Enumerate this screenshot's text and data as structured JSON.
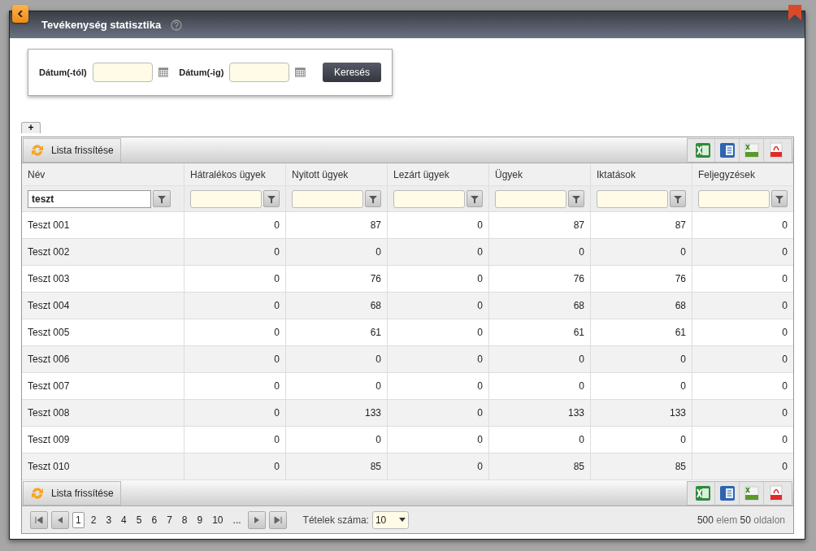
{
  "window": {
    "title": "Tevékenység statisztika"
  },
  "search_form": {
    "fields": [
      {
        "label": "Dátum(-tól)"
      },
      {
        "label": "Dátum(-ig)"
      }
    ],
    "button": "Keresés"
  },
  "add_tab": "+",
  "toolbar": {
    "refresh": "Lista frissítése",
    "exports": [
      {
        "kind": "excel"
      },
      {
        "kind": "word"
      },
      {
        "kind": "csv"
      },
      {
        "kind": "pdf"
      }
    ]
  },
  "table": {
    "columns": [
      "Név",
      "Hátralékos ügyek",
      "Nyitott ügyek",
      "Lezárt ügyek",
      "Ügyek",
      "Iktatások",
      "Feljegyzések"
    ],
    "name_filter": "teszt",
    "rows": [
      [
        "Teszt 001",
        "0",
        "87",
        "0",
        "87",
        "87",
        "0"
      ],
      [
        "Teszt 002",
        "0",
        "0",
        "0",
        "0",
        "0",
        "0"
      ],
      [
        "Teszt 003",
        "0",
        "76",
        "0",
        "76",
        "76",
        "0"
      ],
      [
        "Teszt 004",
        "0",
        "68",
        "0",
        "68",
        "68",
        "0"
      ],
      [
        "Teszt 005",
        "0",
        "61",
        "0",
        "61",
        "61",
        "0"
      ],
      [
        "Teszt 006",
        "0",
        "0",
        "0",
        "0",
        "0",
        "0"
      ],
      [
        "Teszt 007",
        "0",
        "0",
        "0",
        "0",
        "0",
        "0"
      ],
      [
        "Teszt 008",
        "0",
        "133",
        "0",
        "133",
        "133",
        "0"
      ],
      [
        "Teszt 009",
        "0",
        "0",
        "0",
        "0",
        "0",
        "0"
      ],
      [
        "Teszt 010",
        "0",
        "85",
        "0",
        "85",
        "85",
        "0"
      ]
    ]
  },
  "bottom_toolbar": {
    "refresh": "Lista frissítése",
    "exports": [
      {
        "kind": "excel"
      },
      {
        "kind": "word"
      },
      {
        "kind": "csv"
      },
      {
        "kind": "pdf"
      }
    ]
  },
  "pager": {
    "pages": [
      {
        "label": "1",
        "selected": true
      },
      {
        "label": "2",
        "selected": false
      },
      {
        "label": "3",
        "selected": false
      },
      {
        "label": "4",
        "selected": false
      },
      {
        "label": "5",
        "selected": false
      },
      {
        "label": "6",
        "selected": false
      },
      {
        "label": "7",
        "selected": false
      },
      {
        "label": "8",
        "selected": false
      },
      {
        "label": "9",
        "selected": false
      },
      {
        "label": "10",
        "selected": false
      }
    ],
    "ellipsis": "...",
    "page_size_label": "Tételek száma:",
    "page_size": "10",
    "summary": "**500** elem **50** oldalon"
  }
}
